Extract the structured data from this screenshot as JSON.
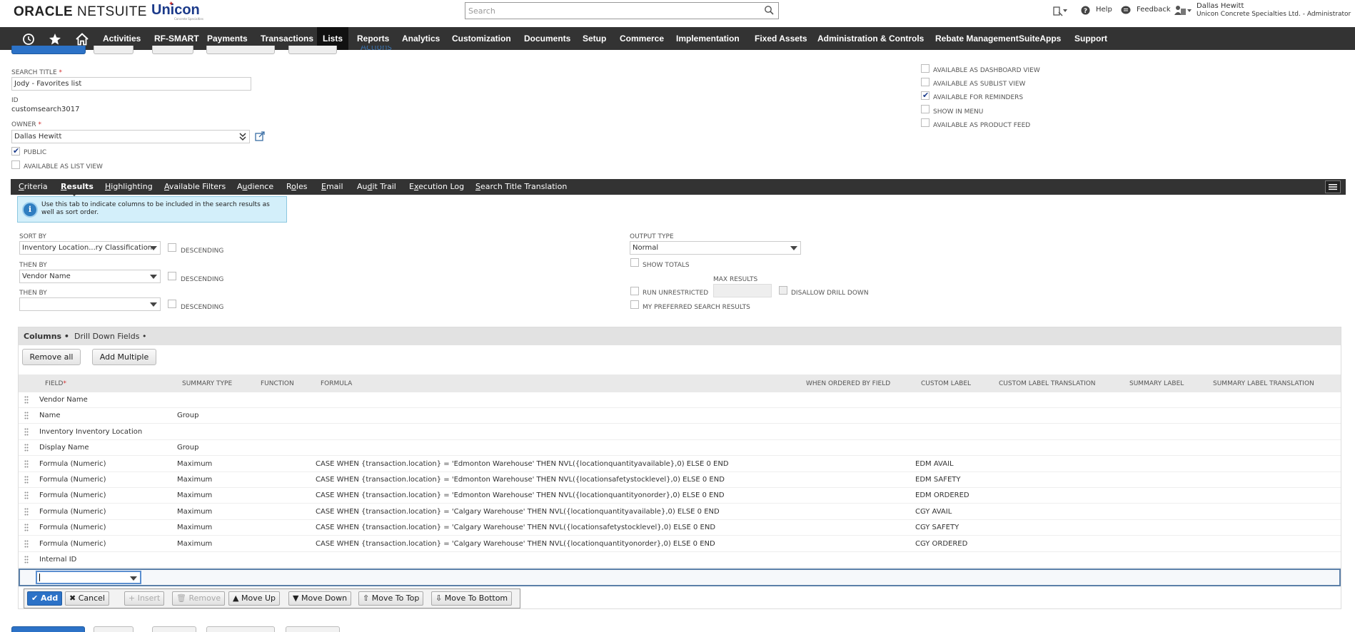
{
  "header": {
    "logo_oracle": "ORACLE",
    "logo_netsuite": "NETSUITE",
    "logo_company": "Unicon",
    "logo_company_sub": "Concrete Specialties",
    "search_placeholder": "Search",
    "help": "Help",
    "feedback": "Feedback",
    "user_name": "Dallas Hewitt",
    "user_role": "Unicon Concrete Specialties Ltd. - Administrator"
  },
  "nav": {
    "items": [
      "Activities",
      "RF-SMART",
      "Payments",
      "Transactions",
      "Lists",
      "Reports",
      "Analytics",
      "Customization",
      "Documents",
      "Setup",
      "Commerce",
      "Implementation",
      "Fixed Assets",
      "Administration & Controls",
      "Rebate Management",
      "SuiteApps",
      "Support"
    ],
    "active": "Lists"
  },
  "form": {
    "search_title_label": "SEARCH TITLE",
    "search_title_value": "Jody - Favorites list",
    "id_label": "ID",
    "id_value": "customsearch3017",
    "owner_label": "OWNER",
    "owner_value": "Dallas Hewitt",
    "public_label": "PUBLIC",
    "public_checked": true,
    "list_view_label": "AVAILABLE AS LIST VIEW",
    "list_view_checked": false,
    "dashboard_label": "AVAILABLE AS DASHBOARD VIEW",
    "sublist_label": "AVAILABLE AS SUBLIST VIEW",
    "reminders_label": "AVAILABLE FOR REMINDERS",
    "reminders_checked": true,
    "menu_label": "SHOW IN MENU",
    "product_feed_label": "AVAILABLE AS PRODUCT FEED",
    "actions_label": "Actions"
  },
  "subtabs": [
    {
      "label": "Criteria",
      "ul": "C",
      "rest": "riteria"
    },
    {
      "label": "Results",
      "ul": "R",
      "rest": "esults"
    },
    {
      "label": "Highlighting",
      "ul": "H",
      "rest": "ighlighting"
    },
    {
      "label": "Available Filters",
      "ul": "A",
      "rest": "vailable Filters"
    },
    {
      "label": "Audience",
      "ul": "u",
      "rest": "dience"
    },
    {
      "label": "Roles",
      "ul": "o",
      "rest": "les"
    },
    {
      "label": "Email",
      "ul": "E",
      "rest": "mail"
    },
    {
      "label": "Audit Trail",
      "ul": "d",
      "rest": "it Trail"
    },
    {
      "label": "Execution Log",
      "ul": "x",
      "rest": "ecution Log"
    },
    {
      "label": "Search Title Translation",
      "ul": "S",
      "rest": "earch Title Translation"
    }
  ],
  "info": "Use this tab to indicate columns to be included in the search results as well as sort order.",
  "sort": {
    "sort_by_label": "SORT BY",
    "sort_by_value": "Inventory Location...ry Classification",
    "then_by_label": "THEN BY",
    "then_by_value": "Vendor Name",
    "then_by2_label": "THEN BY",
    "then_by2_value": "",
    "descending": "DESCENDING"
  },
  "output": {
    "output_type_label": "OUTPUT TYPE",
    "output_type_value": "Normal",
    "show_totals": "SHOW TOTALS",
    "max_results": "MAX RESULTS",
    "run_unrestricted": "RUN UNRESTRICTED",
    "disallow_drill": "DISALLOW DRILL DOWN",
    "preferred": "MY PREFERRED SEARCH RESULTS"
  },
  "columns_panel": {
    "tab_columns": "Columns •",
    "tab_drill": "Drill Down Fields •",
    "remove_all": "Remove all",
    "add_multiple": "Add Multiple",
    "headers": {
      "field": "FIELD",
      "summary_type": "SUMMARY TYPE",
      "function": "FUNCTION",
      "formula": "FORMULA",
      "when_ordered": "WHEN ORDERED BY FIELD",
      "custom_label": "CUSTOM LABEL",
      "custom_label_translation": "CUSTOM LABEL TRANSLATION",
      "summary_label": "SUMMARY LABEL",
      "summary_label_translation": "SUMMARY LABEL TRANSLATION"
    },
    "rows": [
      {
        "field": "Vendor Name",
        "summary": "",
        "formula": "",
        "label": ""
      },
      {
        "field": "Name",
        "summary": "Group",
        "formula": "",
        "label": ""
      },
      {
        "field": "Inventory Inventory Location",
        "summary": "",
        "formula": "",
        "label": ""
      },
      {
        "field": "Display Name",
        "summary": "Group",
        "formula": "",
        "label": ""
      },
      {
        "field": "Formula (Numeric)",
        "summary": "Maximum",
        "formula": "CASE WHEN {transaction.location} = 'Edmonton Warehouse' THEN NVL({locationquantityavailable},0) ELSE 0 END",
        "label": "EDM AVAIL"
      },
      {
        "field": "Formula (Numeric)",
        "summary": "Maximum",
        "formula": "CASE WHEN {transaction.location} = 'Edmonton Warehouse' THEN NVL({locationsafetystocklevel},0) ELSE 0 END",
        "label": "EDM SAFETY"
      },
      {
        "field": "Formula (Numeric)",
        "summary": "Maximum",
        "formula": "CASE WHEN {transaction.location} = 'Edmonton Warehouse' THEN NVL({locationquantityonorder},0) ELSE 0 END",
        "label": "EDM ORDERED"
      },
      {
        "field": "Formula (Numeric)",
        "summary": "Maximum",
        "formula": "CASE WHEN {transaction.location} = 'Calgary Warehouse' THEN NVL({locationquantityavailable},0) ELSE 0 END",
        "label": "CGY AVAIL"
      },
      {
        "field": "Formula (Numeric)",
        "summary": "Maximum",
        "formula": "CASE WHEN {transaction.location} = 'Calgary Warehouse' THEN NVL({locationsafetystocklevel},0) ELSE 0 END",
        "label": "CGY SAFETY"
      },
      {
        "field": "Formula (Numeric)",
        "summary": "Maximum",
        "formula": "CASE WHEN {transaction.location} = 'Calgary Warehouse' THEN NVL({locationquantityonorder},0) ELSE 0 END",
        "label": "CGY ORDERED"
      },
      {
        "field": "Internal ID",
        "summary": "",
        "formula": "",
        "label": ""
      }
    ],
    "edit_buttons": {
      "add": "Add",
      "cancel": "Cancel",
      "insert": "Insert",
      "remove": "Remove",
      "move_up": "Move Up",
      "move_down": "Move Down",
      "move_top": "Move To Top",
      "move_bottom": "Move To Bottom"
    }
  },
  "colors": {
    "nav_bg": "#333333",
    "accent": "#2c72c7",
    "info_bg": "#d3effa"
  }
}
